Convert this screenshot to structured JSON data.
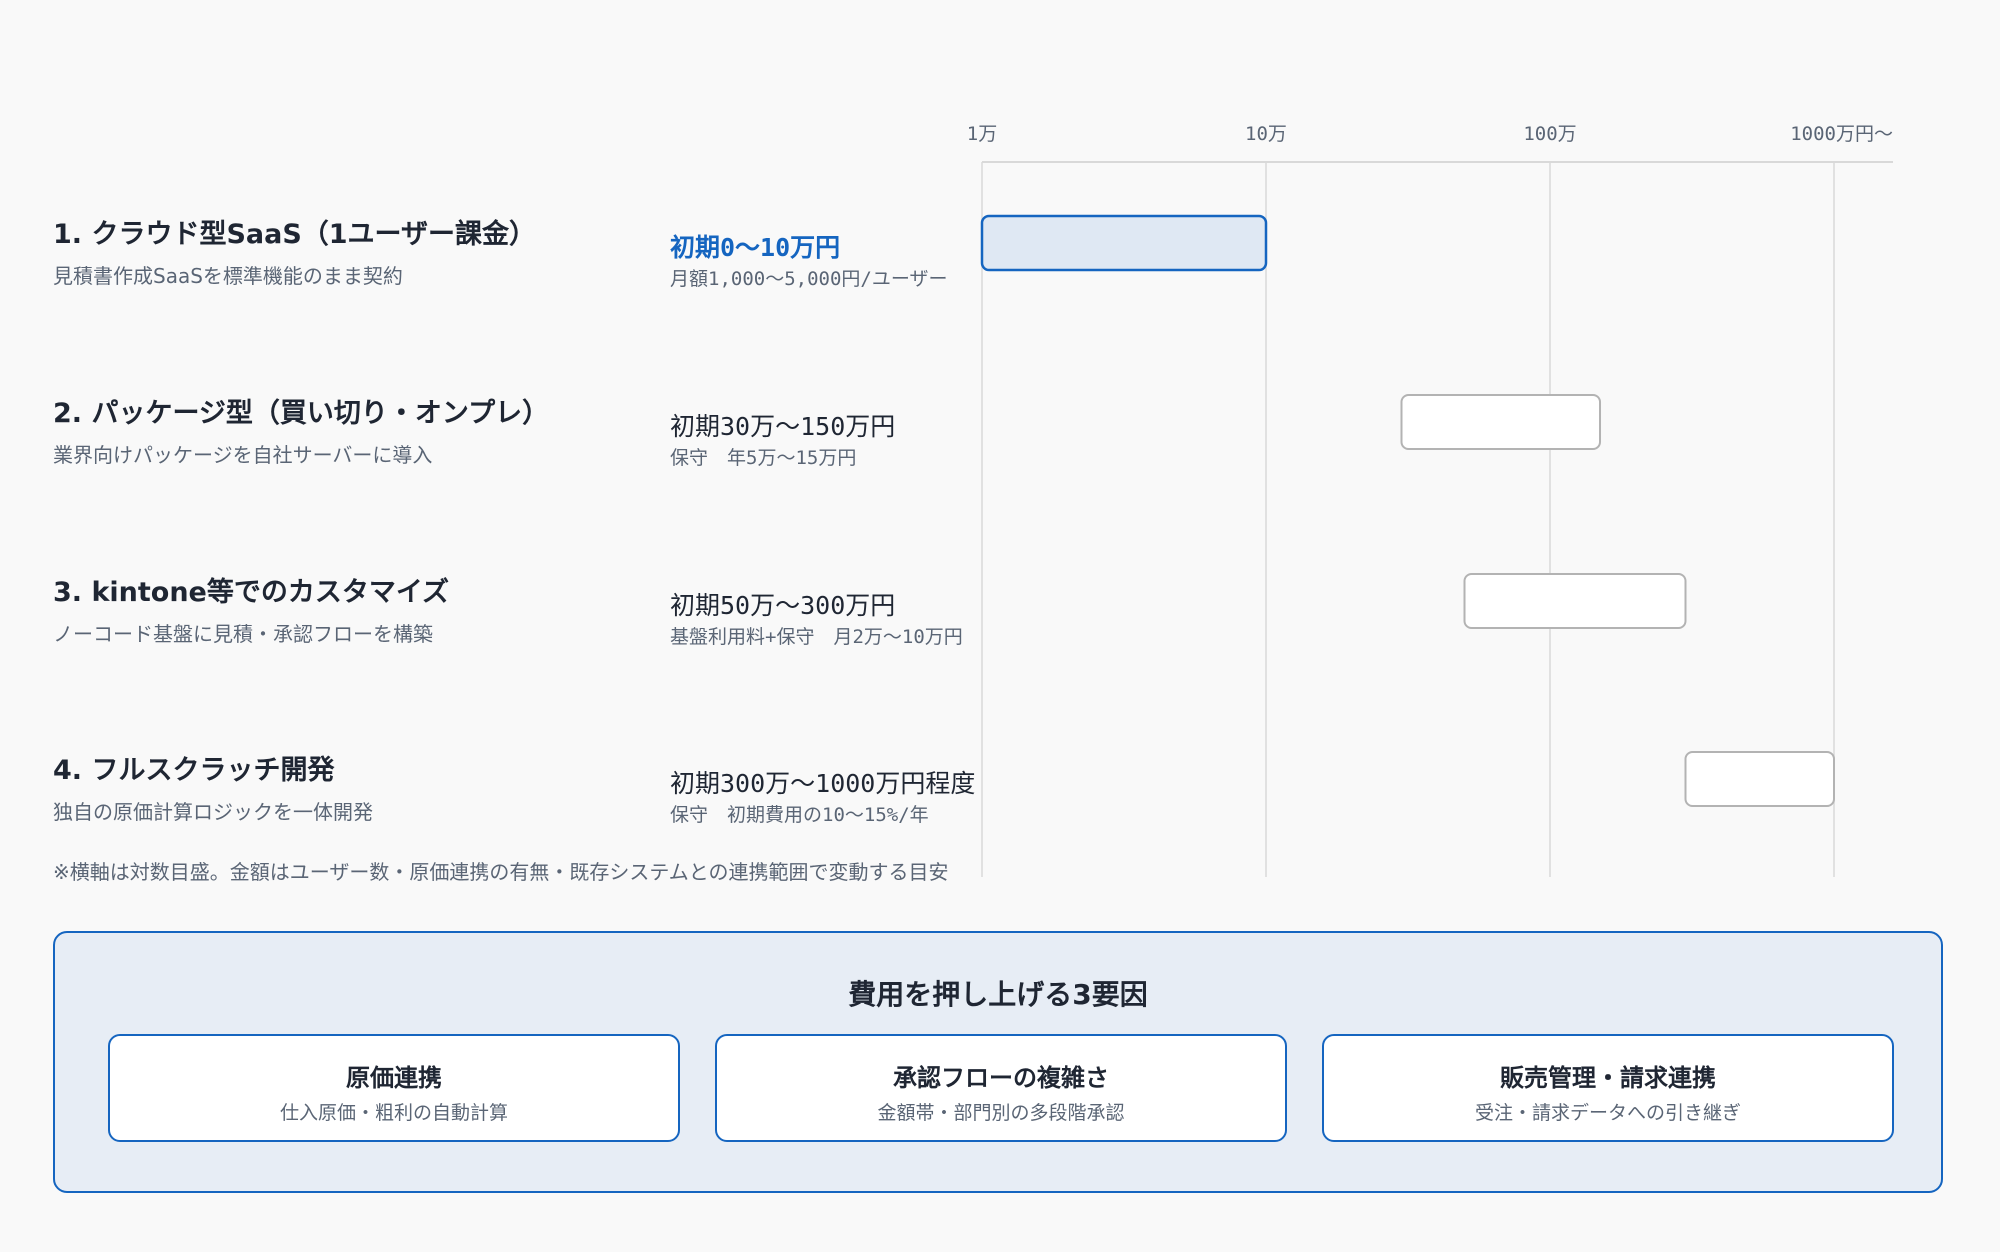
{
  "chart_data": {
    "type": "range-bar",
    "x_scale": "log",
    "x_unit": "円",
    "xlim": [
      10000,
      15000000
    ],
    "ticks": [
      {
        "value": 10000,
        "label": "1万"
      },
      {
        "value": 100000,
        "label": "10万"
      },
      {
        "value": 1000000,
        "label": "100万"
      },
      {
        "value": 10000000,
        "label": "1000万円〜"
      }
    ],
    "grid": true,
    "rows": [
      {
        "title": "1. クラウド型SaaS（1ユーザー課金）",
        "desc": "見積書作成SaaSを標準機能のまま契約",
        "price": "初期0〜10万円",
        "sub": "月額1,000〜5,000円/ユーザー",
        "range": [
          10000,
          100000
        ],
        "highlight": true
      },
      {
        "title": "2. パッケージ型（買い切り・オンプレ）",
        "desc": "業界向けパッケージを自社サーバーに導入",
        "price": "初期30万〜150万円",
        "sub": "保守　年5万〜15万円",
        "range": [
          300000,
          1500000
        ],
        "highlight": false
      },
      {
        "title": "3. kintone等でのカスタマイズ",
        "desc": "ノーコード基盤に見積・承認フローを構築",
        "price": "初期50万〜300万円",
        "sub": "基盤利用料+保守　月2万〜10万円",
        "range": [
          500000,
          3000000
        ],
        "highlight": false
      },
      {
        "title": "4. フルスクラッチ開発",
        "desc": "独自の原価計算ロジックを一体開発",
        "price": "初期300万〜1000万円程度",
        "sub": "保守　初期費用の10〜15%/年",
        "range": [
          3000000,
          10000000
        ],
        "highlight": false
      }
    ],
    "note": "※横軸は対数目盛。金額はユーザー数・原価連携の有無・既存システムとの連携範囲で変動する目安"
  },
  "factors": {
    "title": "費用を押し上げる3要因",
    "items": [
      {
        "name": "原価連携",
        "desc": "仕入原価・粗利の自動計算"
      },
      {
        "name": "承認フローの複雑さ",
        "desc": "金額帯・部門別の多段階承認"
      },
      {
        "name": "販売管理・請求連携",
        "desc": "受注・請求データへの引き継ぎ"
      }
    ]
  },
  "colors": {
    "accent": "#1565c0",
    "highlight_fill": "#dfe8f3",
    "bar_border": "#b3b3b3",
    "grid": "#d9d9d9",
    "text": "#1f2633",
    "muted": "#5a6575"
  }
}
